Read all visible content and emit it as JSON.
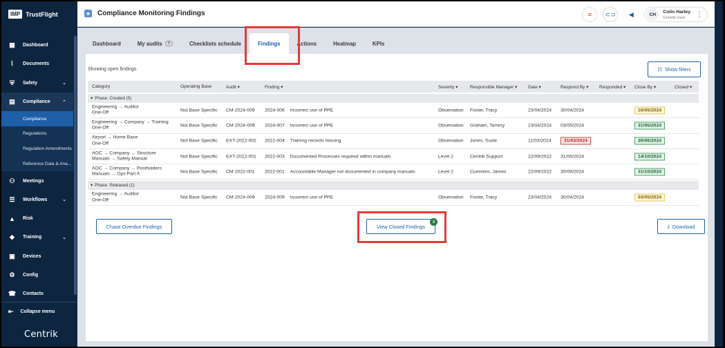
{
  "app": {
    "logo_box": "IMP",
    "logo_text": "TrustFlight",
    "brand_footer": "Centrik"
  },
  "sidebar": {
    "items": [
      {
        "label": "Dashboard",
        "icon": "dashboard-icon",
        "glyph": "▦"
      },
      {
        "label": "Documents",
        "icon": "paperclip-icon",
        "glyph": "⌇"
      },
      {
        "label": "Safety",
        "icon": "shield-icon",
        "glyph": "⛨",
        "chevron": "⌄"
      },
      {
        "label": "Compliance",
        "icon": "compliance-icon",
        "glyph": "▤",
        "chevron": "⌃"
      },
      {
        "label": "Meetings",
        "icon": "meetings-icon",
        "glyph": "⚇"
      },
      {
        "label": "Workflows",
        "icon": "workflows-icon",
        "glyph": "☰",
        "chevron": "⌄"
      },
      {
        "label": "Risk",
        "icon": "warning-icon",
        "glyph": "▲"
      },
      {
        "label": "Training",
        "icon": "graduation-cap-icon",
        "glyph": "◆",
        "chevron": "⌄"
      },
      {
        "label": "Devices",
        "icon": "devices-icon",
        "glyph": "▣"
      },
      {
        "label": "Config",
        "icon": "config-icon",
        "glyph": "⚙"
      },
      {
        "label": "Contacts",
        "icon": "contacts-icon",
        "glyph": "☎"
      }
    ],
    "compliance_sub": [
      "Compliance",
      "Regulations",
      "Regulation Amendments",
      "Reference Data & Ana..."
    ],
    "collapse_label": "Collapse menu"
  },
  "header": {
    "title": "Compliance Monitoring Findings",
    "user_initials": "CH",
    "user_name": "Colin Harley",
    "user_role": "Centrik User"
  },
  "tabs": [
    {
      "label": "Dashboard"
    },
    {
      "label": "My audits",
      "count": "8"
    },
    {
      "label": "Checklists schedule"
    },
    {
      "label": "Findings",
      "active": true
    },
    {
      "label": "Actions"
    },
    {
      "label": "Heatmap"
    },
    {
      "label": "KPIs"
    }
  ],
  "main": {
    "showing": "Showing open findings",
    "show_filters": "Show filters",
    "columns": [
      "Category",
      "Operating Base",
      "Audit ▾",
      "Finding ▾",
      "Severity ▾",
      "Responsible Manager ▾",
      "Date ▾",
      "Respond By ▾",
      "Responded ▾",
      "Close By ▾",
      "Closed ▾"
    ],
    "phase_created": "Phase: Created (5)",
    "phase_released": "Phase: Released (1)",
    "created_rows": [
      {
        "cat1": "Engineering → Auditor",
        "cat2": "One-Off",
        "base": "Not Base Specific",
        "audit": "CM-2024-009",
        "fnum": "2024-006",
        "ftext": "Incorrect use of PPE",
        "severity": "Observation",
        "manager": "Foster, Tracy",
        "date": "23/04/2024",
        "respond_by": "30/04/2024",
        "respond_style": "",
        "close_by": "10/05/2024",
        "close_style": "yellow"
      },
      {
        "cat1": "Engineering → Company → Training",
        "cat2": "One-Off",
        "base": "Not Base Specific",
        "audit": "CM-2024-009",
        "fnum": "2024-007",
        "ftext": "Incorrect use of PPE",
        "severity": "Observation",
        "manager": "Graham, Tammy",
        "date": "23/04/2024",
        "respond_by": "03/05/2024",
        "respond_style": "",
        "close_by": "31/05/2024",
        "close_style": "green"
      },
      {
        "cat1": "Airport → Home Base",
        "cat2": "One-Off",
        "base": "Not Base Specific",
        "audit": "EXT-2022-002",
        "fnum": "2022-004",
        "ftext": "Training records missing",
        "severity": "Observation",
        "manager": "Jones, Suzie",
        "date": "11/03/2024",
        "respond_by": "31/03/2024",
        "respond_style": "red",
        "close_by": "30/06/2024",
        "close_style": "green"
      },
      {
        "cat1": "AOC → Company → Structure",
        "cat2": "Manuals → Safety Manual",
        "base": "Not Base Specific",
        "audit": "EXT-2022-001",
        "fnum": "2022-003",
        "ftext": "Documented Processes required within manuals",
        "severity": "Level 2",
        "manager": "Centrik Support",
        "date": "22/09/2022",
        "respond_by": "31/05/2024",
        "respond_style": "",
        "close_by": "14/10/2024",
        "close_style": "green"
      },
      {
        "cat1": "AOC → Company → Postholders",
        "cat2": "Manuals → Ops Part A",
        "base": "Not Base Specific",
        "audit": "CM-2022-001",
        "fnum": "2022-001",
        "ftext": "Accountable Manager not documented in company manuals",
        "severity": "Level 2",
        "manager": "Cummins, James",
        "date": "22/09/2022",
        "respond_by": "30/09/2024",
        "respond_style": "",
        "close_by": "31/10/2024",
        "close_style": "green"
      }
    ],
    "released_rows": [
      {
        "cat1": "Engineering → Auditor",
        "cat2": "One-Off",
        "base": "Not Base Specific",
        "audit": "CM-2024-009",
        "fnum": "2024-009",
        "ftext": "Incorrect use of PPE",
        "severity": "Observation",
        "manager": "Foster, Tracy",
        "date": "23/04/2024",
        "respond_by": "30/04/2024",
        "respond_style": "",
        "close_by": "03/05/2024",
        "close_style": "yellow"
      }
    ],
    "chase_button": "Chase Overdue Findings",
    "view_closed_button": "View Closed Findings",
    "view_closed_count": "3",
    "download_button": "Download"
  },
  "colors": {
    "accent": "#1f5fa8",
    "sidebar": "#0e2540",
    "highlight": "#e53935"
  }
}
